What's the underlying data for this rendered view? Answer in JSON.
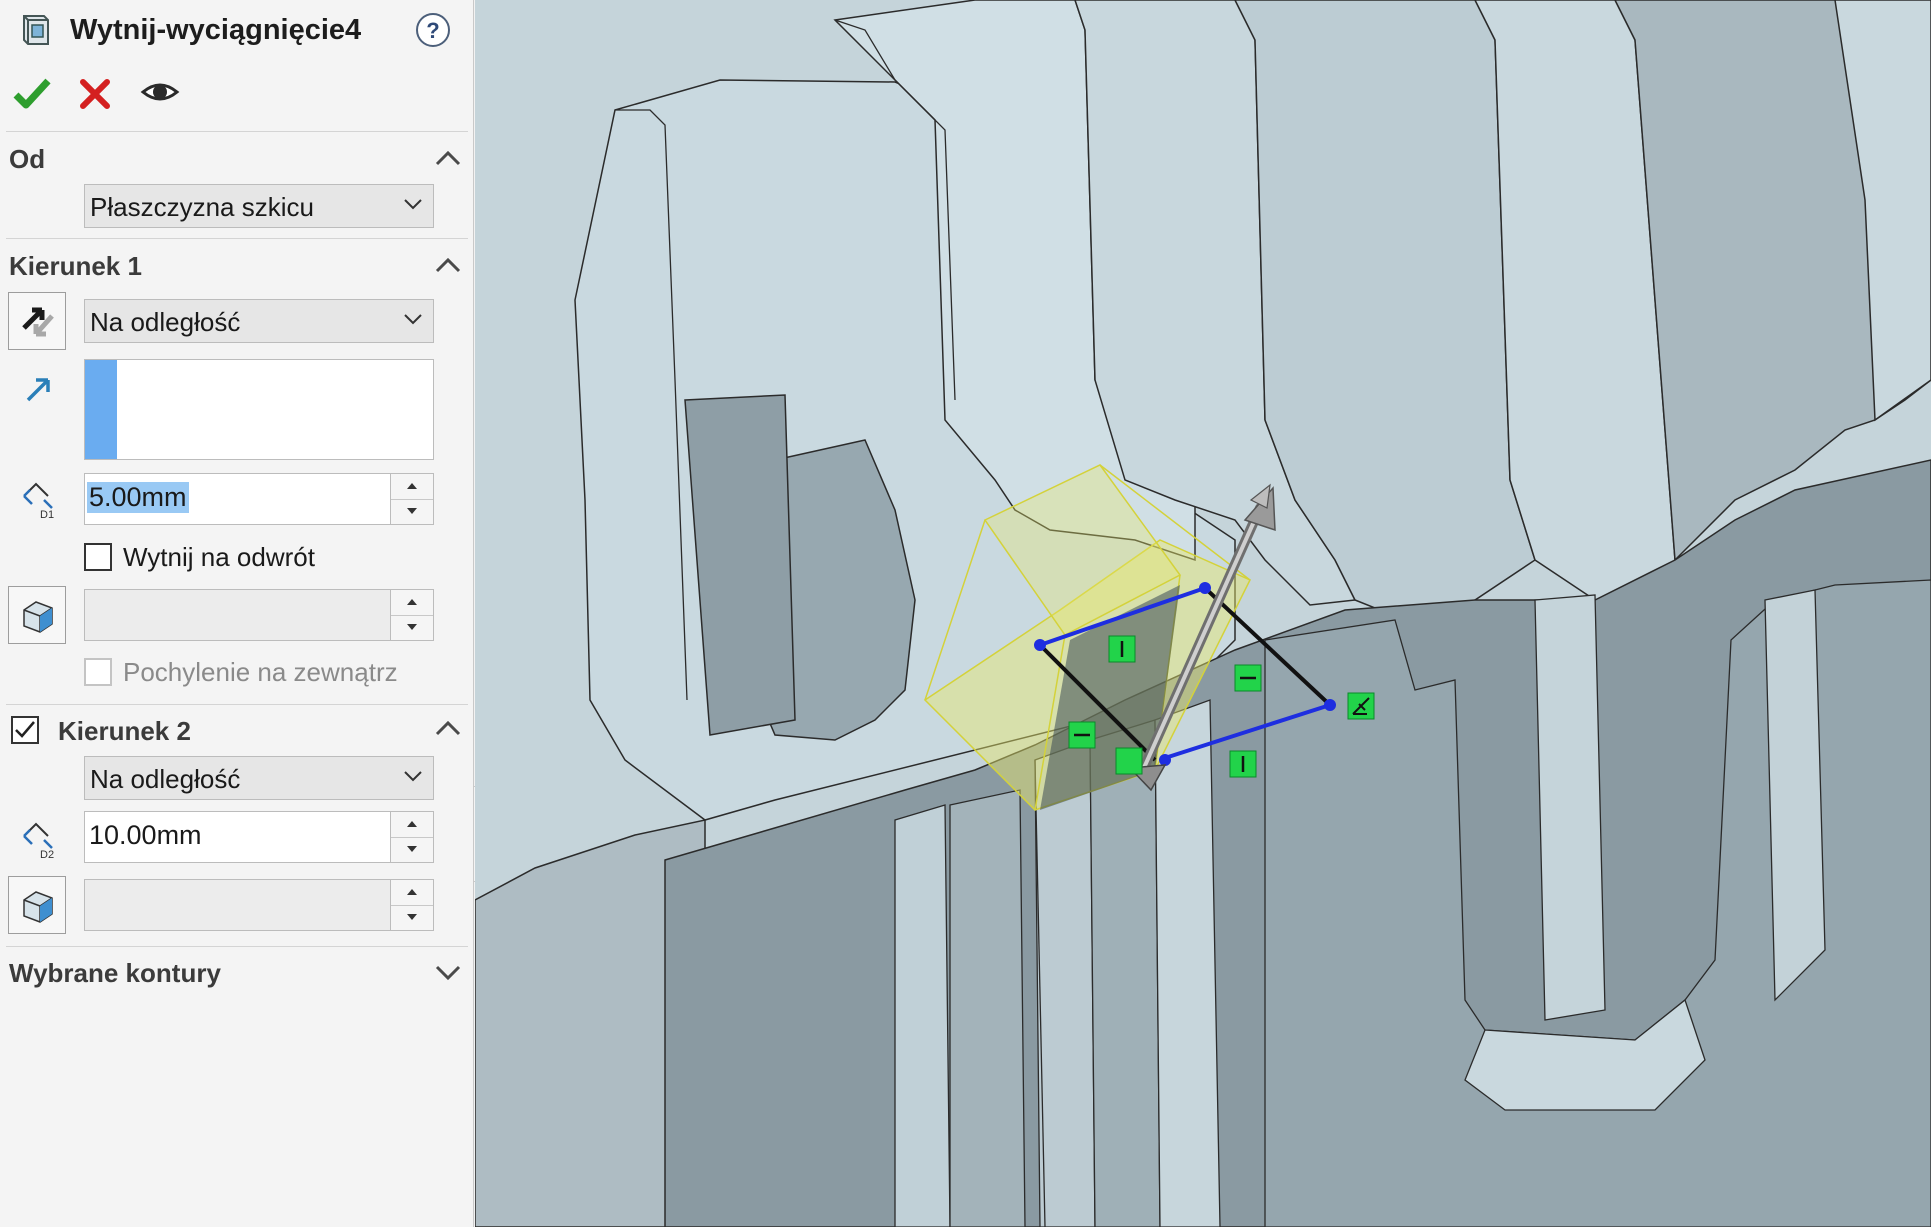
{
  "window": {
    "title": "Wytnij-wyciągnięcie4"
  },
  "toolbar": {
    "ok": "OK",
    "cancel": "Anuluj",
    "preview": "Podgląd"
  },
  "od": {
    "header": "Od",
    "selected": "Płaszczyzna szkicu"
  },
  "kierunek1": {
    "header": "Kierunek 1",
    "end_condition": "Na odległość",
    "selection_list": [],
    "depth_value": "5.00mm",
    "flip_side_label": "Wytnij na odwrót",
    "flip_side_checked": false,
    "draft_value": "",
    "draft_outward_label": "Pochylenie na zewnątrz",
    "draft_outward_checked": false
  },
  "kierunek2": {
    "header": "Kierunek 2",
    "enabled": true,
    "end_condition": "Na odległość",
    "depth_value": "10.00mm",
    "draft_value": ""
  },
  "contours": {
    "header": "Wybrane kontury"
  },
  "icons": {
    "feature": "cut-extrude-icon",
    "help": "help-icon",
    "ok": "checkmark-icon",
    "cancel": "close-icon",
    "preview": "eye-icon",
    "reverse": "reverse-direction-icon",
    "direction": "direction-arrow-icon",
    "depth1": "depth-d1-icon",
    "depth2": "depth-d2-icon",
    "draft": "draft-icon"
  },
  "colors": {
    "ok": "#2e9e2e",
    "cancel": "#d42020",
    "selection": "#99c9f4",
    "model_face": "#c7d6dd",
    "preview_box": "#e9e86a",
    "sketch_line": "#1e2ee0",
    "relation_badge": "#22d34a"
  }
}
